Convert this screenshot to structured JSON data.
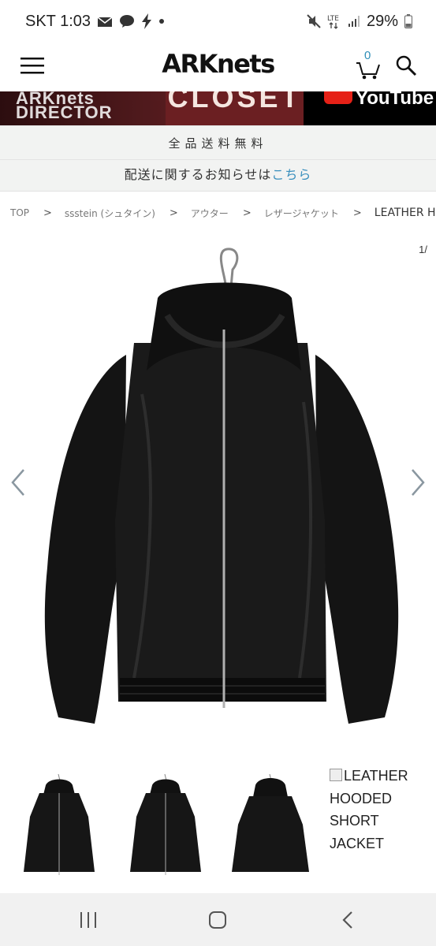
{
  "status": {
    "carrier_time": "SKT 1:03",
    "battery": "29%",
    "icons": [
      "mail-icon",
      "talk-icon",
      "bolt-icon",
      "dot-icon",
      "mute-icon",
      "lte-icon",
      "signal-icon",
      "battery-icon"
    ]
  },
  "header": {
    "logo": "ARKnets",
    "cart_count": "0",
    "icons": [
      "hamburger-menu-icon",
      "cart-icon",
      "search-icon"
    ]
  },
  "banner": {
    "left_text": "ARKnets DIRECTOR",
    "mid_text": "CLOSET",
    "right_text": "YouTube"
  },
  "notices": {
    "free_shipping": "全品送料無料",
    "shipping_prefix": "配送に関するお知らせは",
    "shipping_link": "こちら"
  },
  "breadcrumb": {
    "items": [
      "TOP",
      "ssstein (シュタイン)",
      "アウター",
      "レザージャケット"
    ],
    "current": "LEATHER HOODED S"
  },
  "gallery": {
    "counter": "1/",
    "thumb_alt_text": "LEATHER HOODED SHORT JACKET"
  },
  "colors": {
    "link": "#3a8fbd",
    "banner_bg": "#3a1518",
    "jacket": "#141414"
  }
}
